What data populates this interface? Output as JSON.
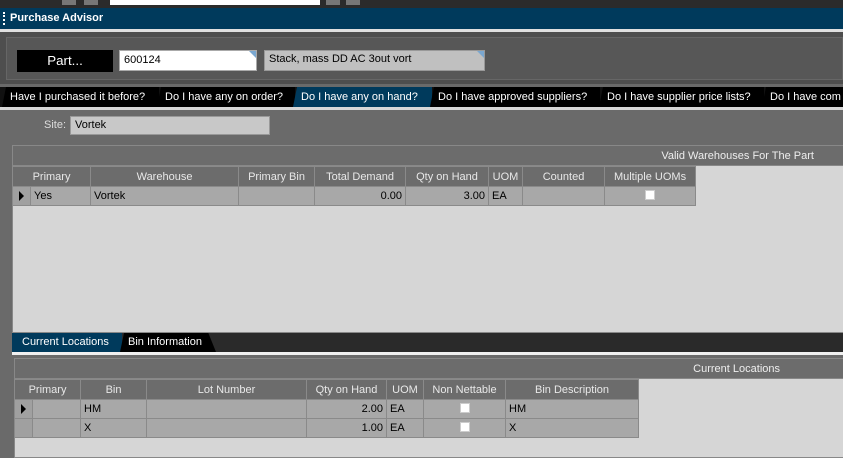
{
  "window": {
    "title": "Purchase Advisor"
  },
  "header": {
    "part_button": "Part...",
    "part_number": "600124",
    "part_description": "Stack, mass DD AC 3out vort"
  },
  "tabs": [
    {
      "label": "Have I purchased it before?",
      "active": false
    },
    {
      "label": "Do I have any on order?",
      "active": false
    },
    {
      "label": "Do I have any on hand?",
      "active": true
    },
    {
      "label": "Do I have approved suppliers?",
      "active": false
    },
    {
      "label": "Do I have supplier price lists?",
      "active": false
    },
    {
      "label": "Do I have com",
      "active": false
    }
  ],
  "site": {
    "label": "Site:",
    "value": "Vortek"
  },
  "warehouses": {
    "title": "Valid Warehouses For The Part",
    "columns": [
      "Primary",
      "Warehouse",
      "Primary Bin",
      "Total Demand",
      "Qty on Hand",
      "UOM",
      "Counted",
      "Multiple UOMs"
    ],
    "rows": [
      {
        "primary": "Yes",
        "warehouse": "Vortek",
        "primary_bin": "",
        "total_demand": "0.00",
        "qty_on_hand": "3.00",
        "uom": "EA",
        "counted": "",
        "multiple_uoms": false
      }
    ]
  },
  "subtabs": [
    {
      "label": "Current Locations",
      "active": true
    },
    {
      "label": "Bin Information",
      "active": false
    }
  ],
  "locations": {
    "title": "Current Locations",
    "columns": [
      "Primary",
      "Bin",
      "Lot Number",
      "Qty on Hand",
      "UOM",
      "Non Nettable",
      "Bin Description"
    ],
    "rows": [
      {
        "primary": "",
        "bin": "HM",
        "lot": "",
        "qty_on_hand": "2.00",
        "uom": "EA",
        "non_nettable": false,
        "description": "HM"
      },
      {
        "primary": "",
        "bin": "X",
        "lot": "",
        "qty_on_hand": "1.00",
        "uom": "EA",
        "non_nettable": false,
        "description": "X"
      }
    ]
  }
}
